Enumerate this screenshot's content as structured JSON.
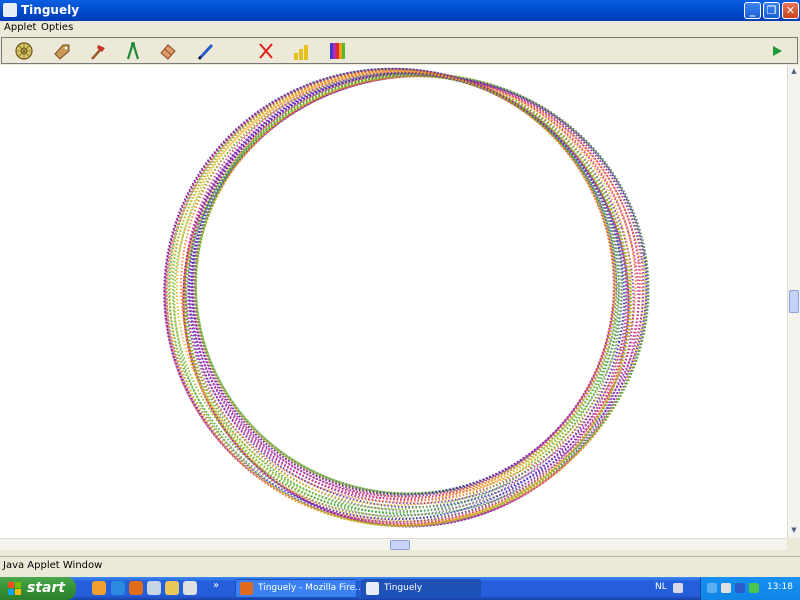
{
  "window": {
    "title": "Tinguely"
  },
  "menu": {
    "items": [
      {
        "label": "Applet"
      },
      {
        "label": "Opties"
      }
    ]
  },
  "toolbar": {
    "tools": [
      {
        "icon": "gear-wheel-icon"
      },
      {
        "icon": "tag-icon"
      },
      {
        "icon": "hammer-icon"
      },
      {
        "icon": "compass-icon"
      },
      {
        "icon": "eraser-icon"
      },
      {
        "icon": "pen-icon"
      },
      {
        "icon": "clear-x-icon"
      },
      {
        "icon": "bar-chart-icon"
      },
      {
        "icon": "color-palette-icon"
      },
      {
        "icon": "play-icon"
      }
    ]
  },
  "colors": {
    "title_bar": "#0a5fe0",
    "ring_colors": [
      "#3c1fc8",
      "#8a23a8",
      "#d0287e",
      "#f07a1e",
      "#e5b51f",
      "#7bb82a",
      "#3aa53a",
      "#7a7a7a"
    ]
  },
  "statusbar": {
    "text": "Java Applet Window"
  },
  "taskbar": {
    "start_label": "start",
    "tasks": [
      {
        "label": "Tinguely - Mozilla Fire..."
      },
      {
        "label": "Tinguely"
      }
    ],
    "overflow": "»",
    "language": "NL",
    "time": "13:18"
  }
}
